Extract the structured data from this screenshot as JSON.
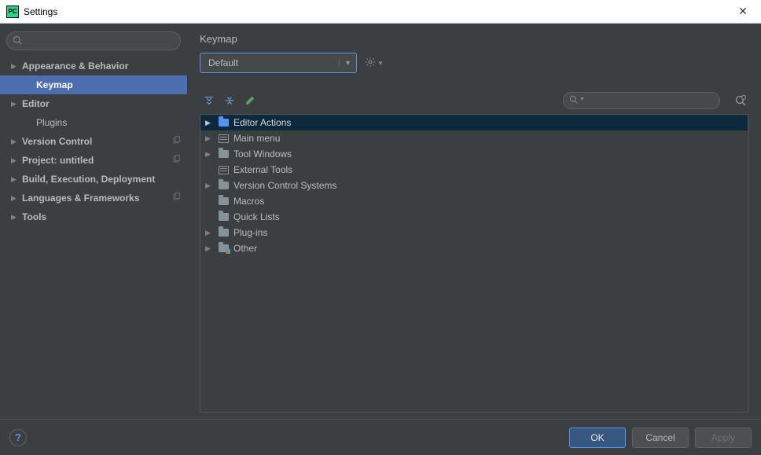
{
  "window": {
    "title": "Settings"
  },
  "sidebar": {
    "search_placeholder": "",
    "items": [
      {
        "label": "Appearance & Behavior",
        "expandable": true,
        "bold": true
      },
      {
        "label": "Keymap",
        "selected": true,
        "indent": true,
        "bold": true
      },
      {
        "label": "Editor",
        "expandable": true,
        "bold": true
      },
      {
        "label": "Plugins",
        "indent": true
      },
      {
        "label": "Version Control",
        "expandable": true,
        "bold": true,
        "copy": true
      },
      {
        "label": "Project: untitled",
        "expandable": true,
        "bold": true,
        "copy": true
      },
      {
        "label": "Build, Execution, Deployment",
        "expandable": true,
        "bold": true
      },
      {
        "label": "Languages & Frameworks",
        "expandable": true,
        "bold": true,
        "copy": true
      },
      {
        "label": "Tools",
        "expandable": true,
        "bold": true
      }
    ]
  },
  "panel": {
    "title": "Keymap",
    "scheme": "Default",
    "filter_placeholder": "",
    "tree": [
      {
        "label": "Editor Actions",
        "expandable": true,
        "selected": true,
        "icon": "folder-blue"
      },
      {
        "label": "Main menu",
        "expandable": true,
        "icon": "menu"
      },
      {
        "label": "Tool Windows",
        "expandable": true,
        "icon": "folder"
      },
      {
        "label": "External Tools",
        "icon": "menu"
      },
      {
        "label": "Version Control Systems",
        "expandable": true,
        "icon": "folder"
      },
      {
        "label": "Macros",
        "icon": "folder"
      },
      {
        "label": "Quick Lists",
        "icon": "folder"
      },
      {
        "label": "Plug-ins",
        "expandable": true,
        "icon": "folder"
      },
      {
        "label": "Other",
        "expandable": true,
        "icon": "folder-multi"
      }
    ]
  },
  "footer": {
    "ok": "OK",
    "cancel": "Cancel",
    "apply": "Apply"
  }
}
